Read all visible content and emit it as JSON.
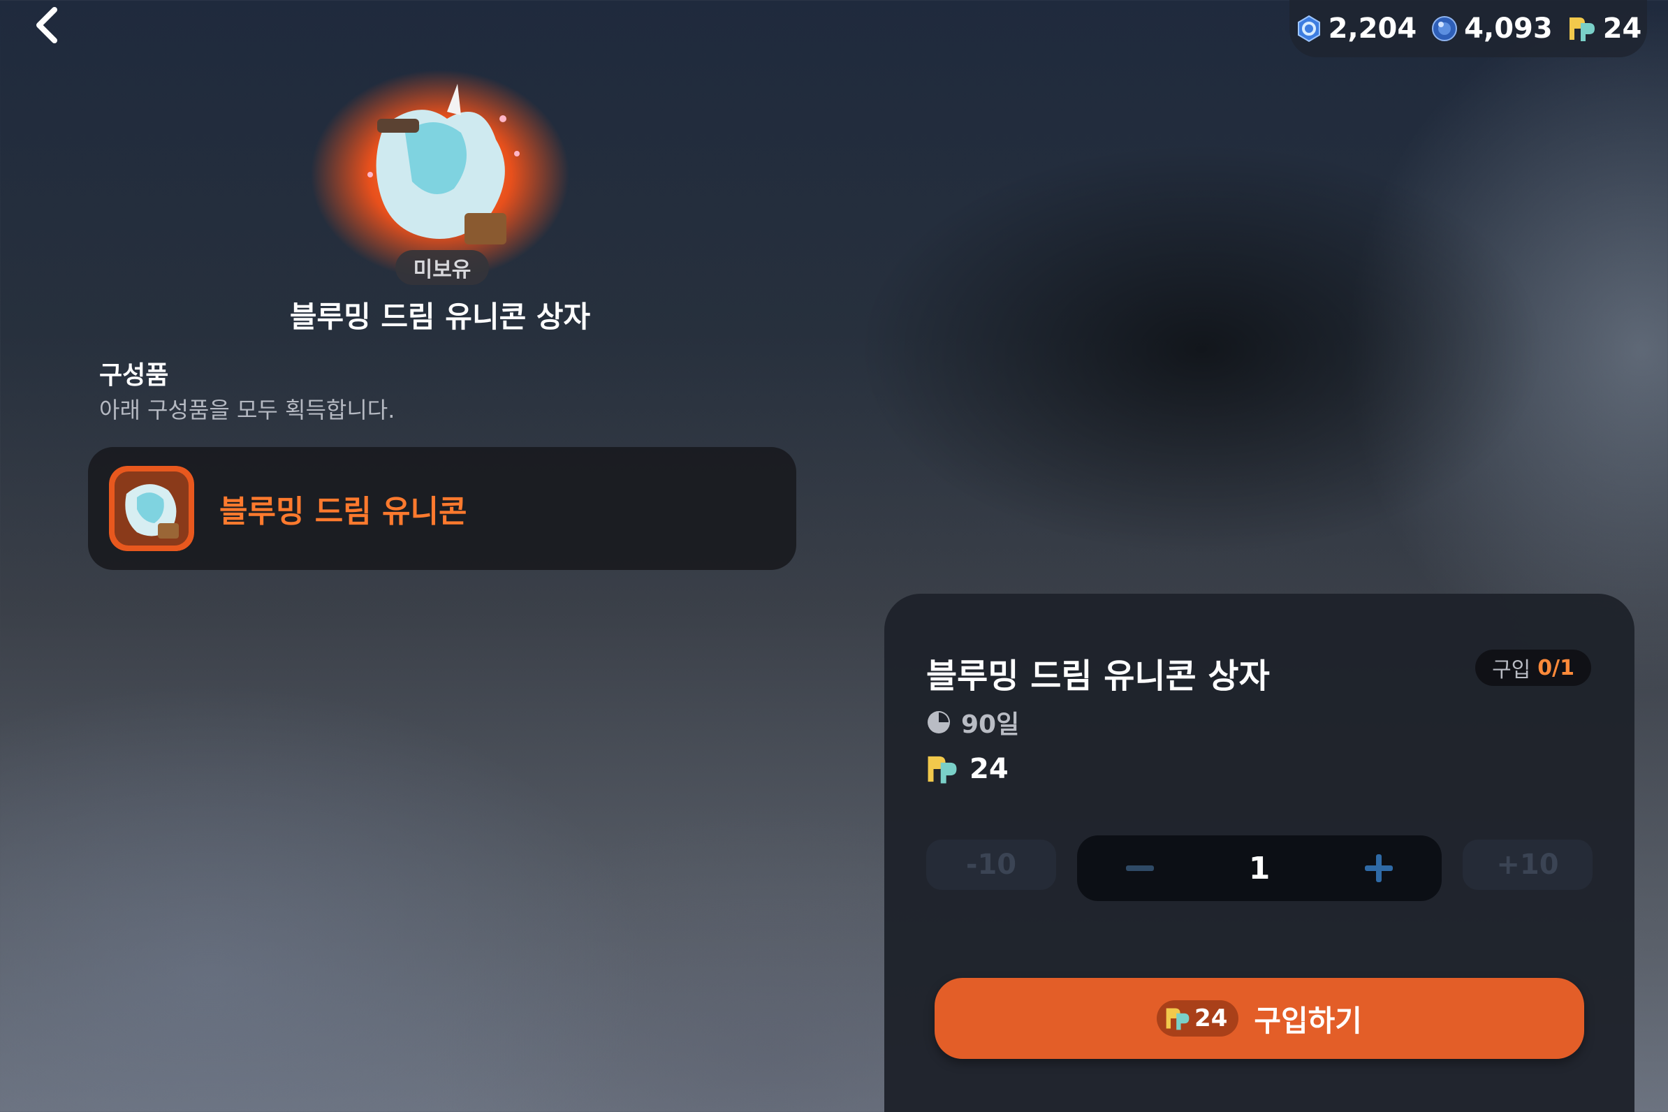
{
  "header": {
    "currencies": [
      {
        "icon": "blue-gem-icon",
        "value": "2,204"
      },
      {
        "icon": "blue-orb-icon",
        "value": "4,093"
      },
      {
        "icon": "rp-points-icon",
        "value": "24"
      }
    ]
  },
  "product": {
    "badge": "미보유",
    "title": "블루밍 드림 유니콘 상자"
  },
  "contents": {
    "title": "구성품",
    "subtitle": "아래 구성품을 모두 획득합니다.",
    "items": [
      {
        "name": "블루밍 드림 유니콘"
      }
    ]
  },
  "purchase": {
    "title": "블루밍 드림 유니콘 상자",
    "limit_label": "구입",
    "limit_value": "0/1",
    "duration": "90일",
    "price": "24",
    "minus10": "-10",
    "plus10": "+10",
    "quantity": "1",
    "buy_price": "24",
    "buy_label": "구입하기"
  },
  "colors": {
    "accent": "#e35e28",
    "item_name": "#ff7a2e",
    "panel": "#1e222b"
  }
}
